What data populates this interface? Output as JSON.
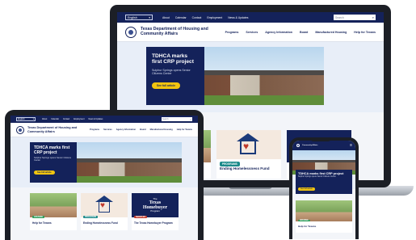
{
  "site": {
    "lang_label": "English",
    "lang_chevron": "▾",
    "search_placeholder": "Search",
    "search_icon": "magnifier-icon",
    "utility_links": [
      "About",
      "Calendar",
      "Contact",
      "Employment",
      "News & Updates"
    ],
    "agency_name_line1": "Texas Department of Housing and",
    "agency_name_line2": "Community Affairs",
    "nav_items": [
      "Programs",
      "Services",
      "Agency Information",
      "Board",
      "Manufactured Housing",
      "Help for Texans"
    ]
  },
  "hero": {
    "title": "TDHCA marks first CRP project",
    "subtitle": "Sulphur Springs opens Senior Citizens Center",
    "button_label": "See full article"
  },
  "cards": [
    {
      "badge": "HOUSING",
      "badge_color": "#2e9d5b",
      "title": "Help for Texans",
      "image": "people-photo"
    },
    {
      "badge": "PROGRAMS",
      "badge_color": "#1b8a8a",
      "title": "Ending Homelessness Fund",
      "image": "heart-house-icon"
    },
    {
      "badge": "SERVICES",
      "badge_color": "#c0392b",
      "title": "The Texas Homebuyer Program",
      "image": "homebuyer-logo"
    }
  ],
  "homebuyer_logo": {
    "line1": "The",
    "line2": "Texas",
    "line3": "Homebuyer",
    "line4": "Program"
  },
  "colors": {
    "navy": "#14225a",
    "yellow": "#f1c40f",
    "heart_red": "#c0392b"
  }
}
